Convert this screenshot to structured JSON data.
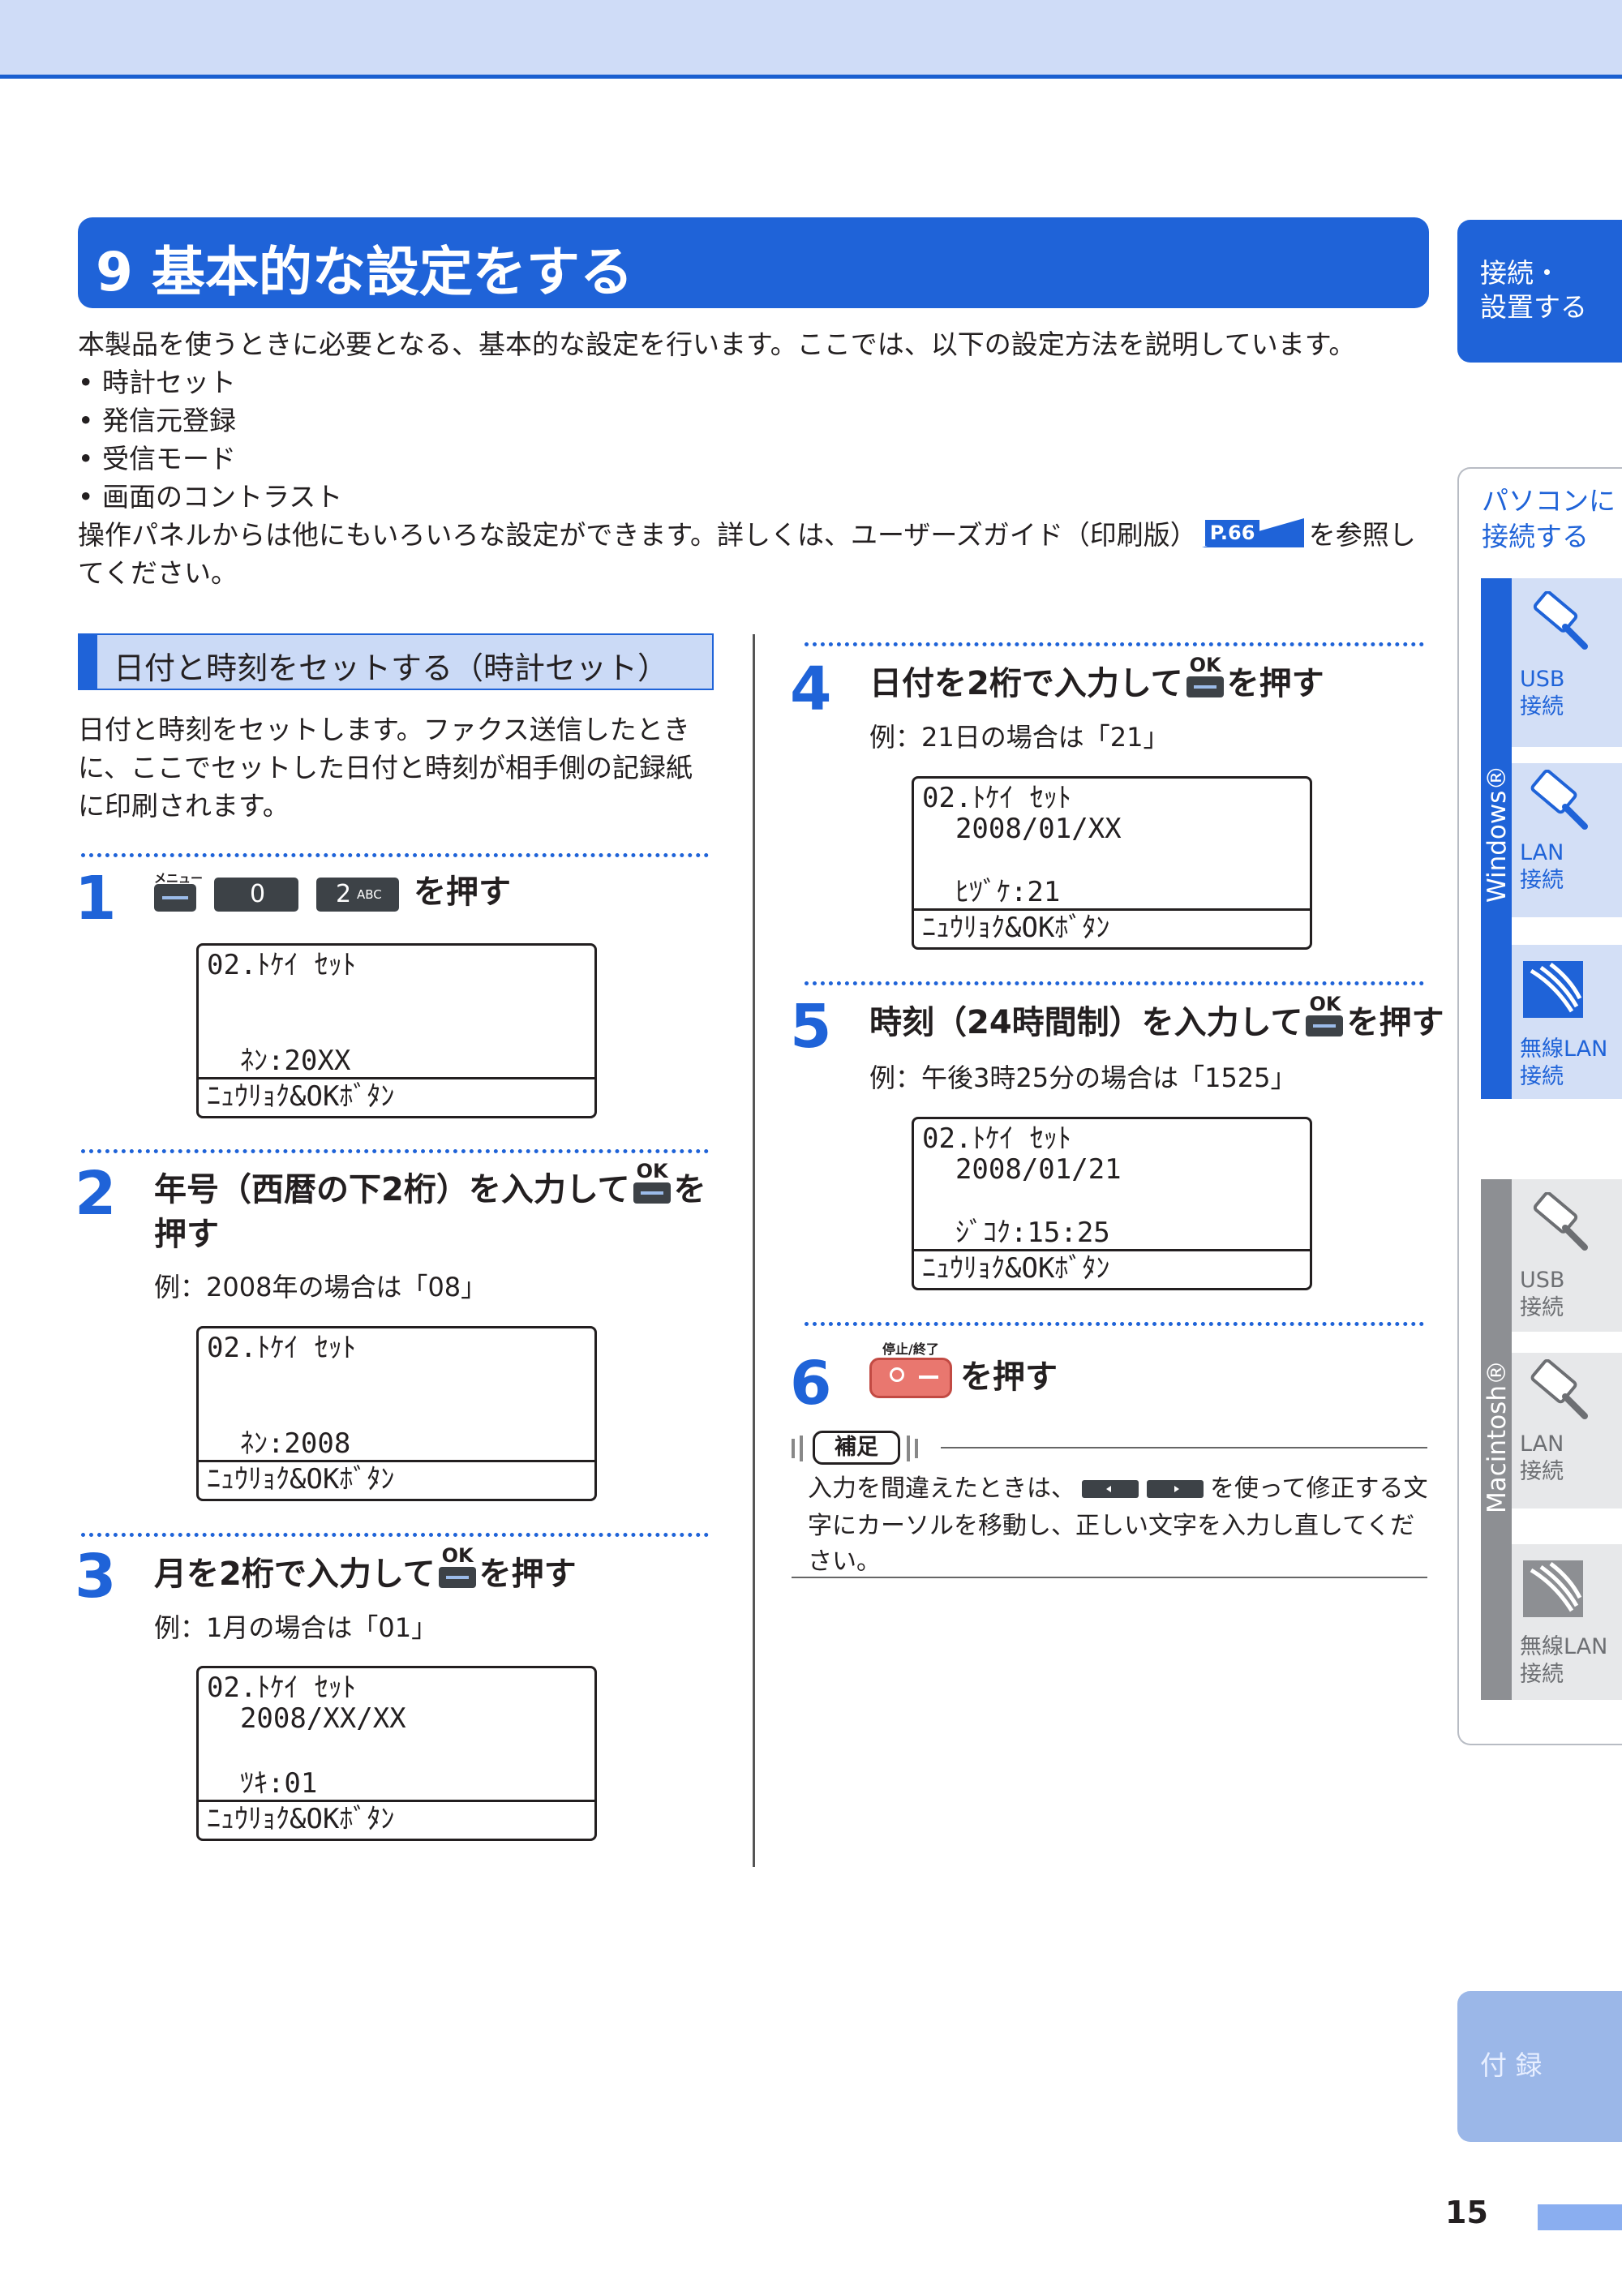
{
  "title": "9 基本的な設定をする",
  "intro": {
    "line1": "本製品を使うときに必要となる、基本的な設定を行います。ここでは、以下の設定方法を説明しています。",
    "bullets": [
      "• 時計セット",
      "• 発信元登録",
      "• 受信モード",
      "• 画面のコントラスト"
    ],
    "line2_a": "操作パネルからは他にもいろいろな設定ができます。詳しくは、ユーザーズガイド（印刷版）",
    "ref": "P.66",
    "line2_b": "を参照し",
    "line3": "てください。"
  },
  "section": {
    "heading": "日付と時刻をセットする（時計セット）",
    "desc": [
      "日付と時刻をセットします。ファクス送信したとき",
      "に、ここでセットした日付と時刻が相手側の記録紙",
      "に印刷されます。"
    ]
  },
  "steps": [
    {
      "num": "1",
      "keys": {
        "menu_label": "メニュー",
        "k0": "0",
        "k2": "2",
        "k2_sub": "ABC"
      },
      "text_after": "を押す",
      "lcd": [
        "02.ﾄｹｲ ｾｯﾄ",
        "",
        "",
        "  ﾈﾝ:20XX",
        "ﾆｭｳﾘｮｸ&OKﾎﾞﾀﾝ"
      ]
    },
    {
      "num": "2",
      "text_a": "年号（西暦の下2桁）を入力して",
      "text_b": "を",
      "text_c": "押す",
      "example": "例：2008年の場合は「08」",
      "lcd": [
        "02.ﾄｹｲ ｾｯﾄ",
        "",
        "",
        "  ﾈﾝ:2008",
        "ﾆｭｳﾘｮｸ&OKﾎﾞﾀﾝ"
      ]
    },
    {
      "num": "3",
      "text_a": "月を2桁で入力して",
      "text_b": "を押す",
      "example": "例：1月の場合は「01」",
      "lcd": [
        "02.ﾄｹｲ ｾｯﾄ",
        "  2008/XX/XX",
        "",
        "  ﾂｷ:01",
        "ﾆｭｳﾘｮｸ&OKﾎﾞﾀﾝ"
      ]
    },
    {
      "num": "4",
      "text_a": "日付を2桁で入力して",
      "text_b": "を押す",
      "example": "例：21日の場合は「21」",
      "lcd": [
        "02.ﾄｹｲ ｾｯﾄ",
        "  2008/01/XX",
        "",
        "  ﾋﾂﾞｹ:21",
        "ﾆｭｳﾘｮｸ&OKﾎﾞﾀﾝ"
      ]
    },
    {
      "num": "5",
      "text_a": "時刻（24時間制）を入力して",
      "text_b": "を押す",
      "example": "例：午後3時25分の場合は「1525」",
      "lcd": [
        "02.ﾄｹｲ ｾｯﾄ",
        "  2008/01/21",
        "",
        "  ｼﾞｺｸ:15:25",
        "ﾆｭｳﾘｮｸ&OKﾎﾞﾀﾝ"
      ]
    },
    {
      "num": "6",
      "stop_label": "停止/終了",
      "text_after": "を押す"
    }
  ],
  "ok_label": "OK",
  "note": {
    "label": "補足",
    "text_a": "入力を間違えたときは、",
    "text_b": "を使って修正する文",
    "line2": "字にカーソルを移動し、正しい文字を入力し直してくだ",
    "line3": "さい。"
  },
  "sidebar": {
    "tab1": [
      "接続・",
      "設置する"
    ],
    "tab2": [
      "パソコンに",
      "接続する"
    ],
    "windows": "Windows®",
    "mac": "Macintosh®",
    "usb": [
      "USB",
      "接続"
    ],
    "lan": [
      "LAN",
      "接続"
    ],
    "wlan": [
      "無線LAN",
      "接続"
    ],
    "appendix": "付 録"
  },
  "page_number": "15",
  "colors": {
    "accent": "#1f63d8",
    "light_accent": "#cbdaf6",
    "gray": "#8d8f93"
  }
}
